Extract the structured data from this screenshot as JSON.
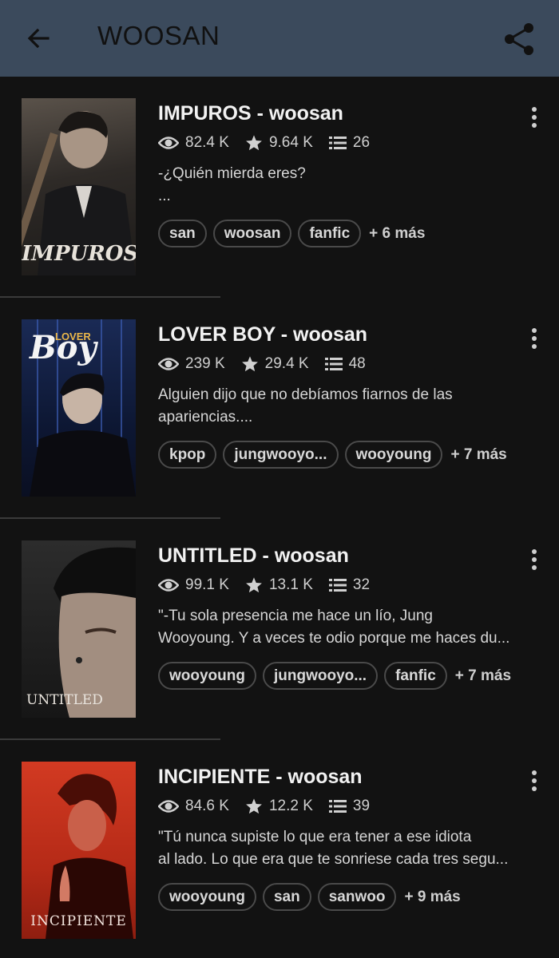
{
  "header": {
    "title": "WOOSAN",
    "back_icon": "arrow-left-icon",
    "share_icon": "share-icon",
    "bg_color": "#3b4a5c"
  },
  "stories": [
    {
      "title": "IMPUROS - woosan",
      "views": "82.4 K",
      "votes": "9.64 K",
      "parts": "26",
      "desc_lines": [
        "-¿Quién mierda eres?",
        "..."
      ],
      "tags": [
        "san",
        "woosan",
        "fanfic"
      ],
      "more": "+ 6 más",
      "cover_text": "IMPUROS"
    },
    {
      "title": "LOVER BOY - woosan",
      "views": "239 K",
      "votes": "29.4 K",
      "parts": "48",
      "desc_lines": [
        "Alguien dijo que no debíamos fiarnos de las",
        "apariencias...."
      ],
      "tags": [
        "kpop",
        "jungwooyo...",
        "wooyoung"
      ],
      "more": "+ 7 más",
      "cover_text_top": "LOVER",
      "cover_text": "Boy"
    },
    {
      "title": "UNTITLED - woosan",
      "views": "99.1 K",
      "votes": "13.1 K",
      "parts": "32",
      "desc_lines": [
        "\"-Tu sola presencia me hace un lío, Jung",
        "Wooyoung. Y a veces te odio porque me haces du..."
      ],
      "tags": [
        "wooyoung",
        "jungwooyo...",
        "fanfic"
      ],
      "more": "+ 7 más",
      "cover_text": "UNTITLED"
    },
    {
      "title": "INCIPIENTE - woosan",
      "views": "84.6 K",
      "votes": "12.2 K",
      "parts": "39",
      "desc_lines": [
        "\"Tú nunca supiste lo que era tener a ese idiota",
        "al lado. Lo que era que te sonriese cada tres segu..."
      ],
      "tags": [
        "wooyoung",
        "san",
        "sanwoo"
      ],
      "more": "+ 9 más",
      "cover_text": "INCIPIENTE"
    }
  ]
}
